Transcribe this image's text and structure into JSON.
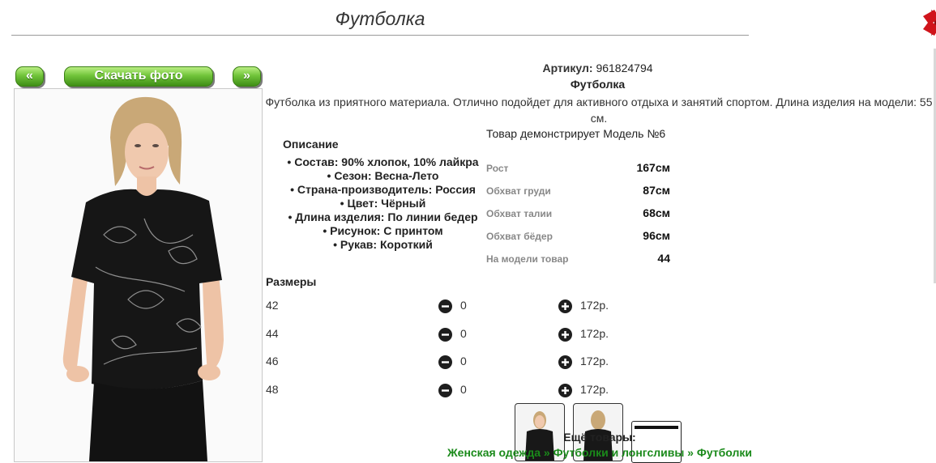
{
  "page": {
    "title": "Футболка"
  },
  "gallery": {
    "prev_label": "«",
    "download_label": "Скачать фото",
    "next_label": "»"
  },
  "product": {
    "article_label": "Артикул:",
    "article_value": "961824794",
    "name": "Футболка",
    "description": "Футболка из приятного материала. Отлично подойдет для активного отдыха и занятий спортом. Длина изделия на модели: 55 см.",
    "model_caption": "Товар демонстрирует Модель №6",
    "description_heading": "Описание",
    "properties": [
      "Состав: 90% хлопок, 10% лайкра",
      "Сезон: Весна-Лето",
      "Страна-производитель: Россия",
      "Цвет: Чёрный",
      "Длина изделия: По линии бедер",
      "Рисунок: С принтом",
      "Рукав: Короткий"
    ]
  },
  "model": [
    {
      "label": "Рост",
      "value": "167см"
    },
    {
      "label": "Обхват груди",
      "value": "87см"
    },
    {
      "label": "Обхват талии",
      "value": "68см"
    },
    {
      "label": "Обхват бёдер",
      "value": "96см"
    },
    {
      "label": "На модели товар",
      "value": "44"
    }
  ],
  "sizes": {
    "heading": "Размеры",
    "rows": [
      {
        "size": "42",
        "qty": "0",
        "price": "172р."
      },
      {
        "size": "44",
        "qty": "0",
        "price": "172р."
      },
      {
        "size": "46",
        "qty": "0",
        "price": "172р."
      },
      {
        "size": "48",
        "qty": "0",
        "price": "172р."
      }
    ]
  },
  "footer": {
    "more_label": "Ещё товары:",
    "breadcrumb": [
      "Женская одежда",
      "Футболки и лонгсливы",
      "Футболки"
    ],
    "separator": " » "
  },
  "colors": {
    "button_green": "#71c43a",
    "close_red": "#d0141b",
    "link_green": "#1a8a1a"
  },
  "icons": {
    "close": "close-icon",
    "minus": "minus-circle-icon",
    "plus": "plus-circle-icon"
  }
}
